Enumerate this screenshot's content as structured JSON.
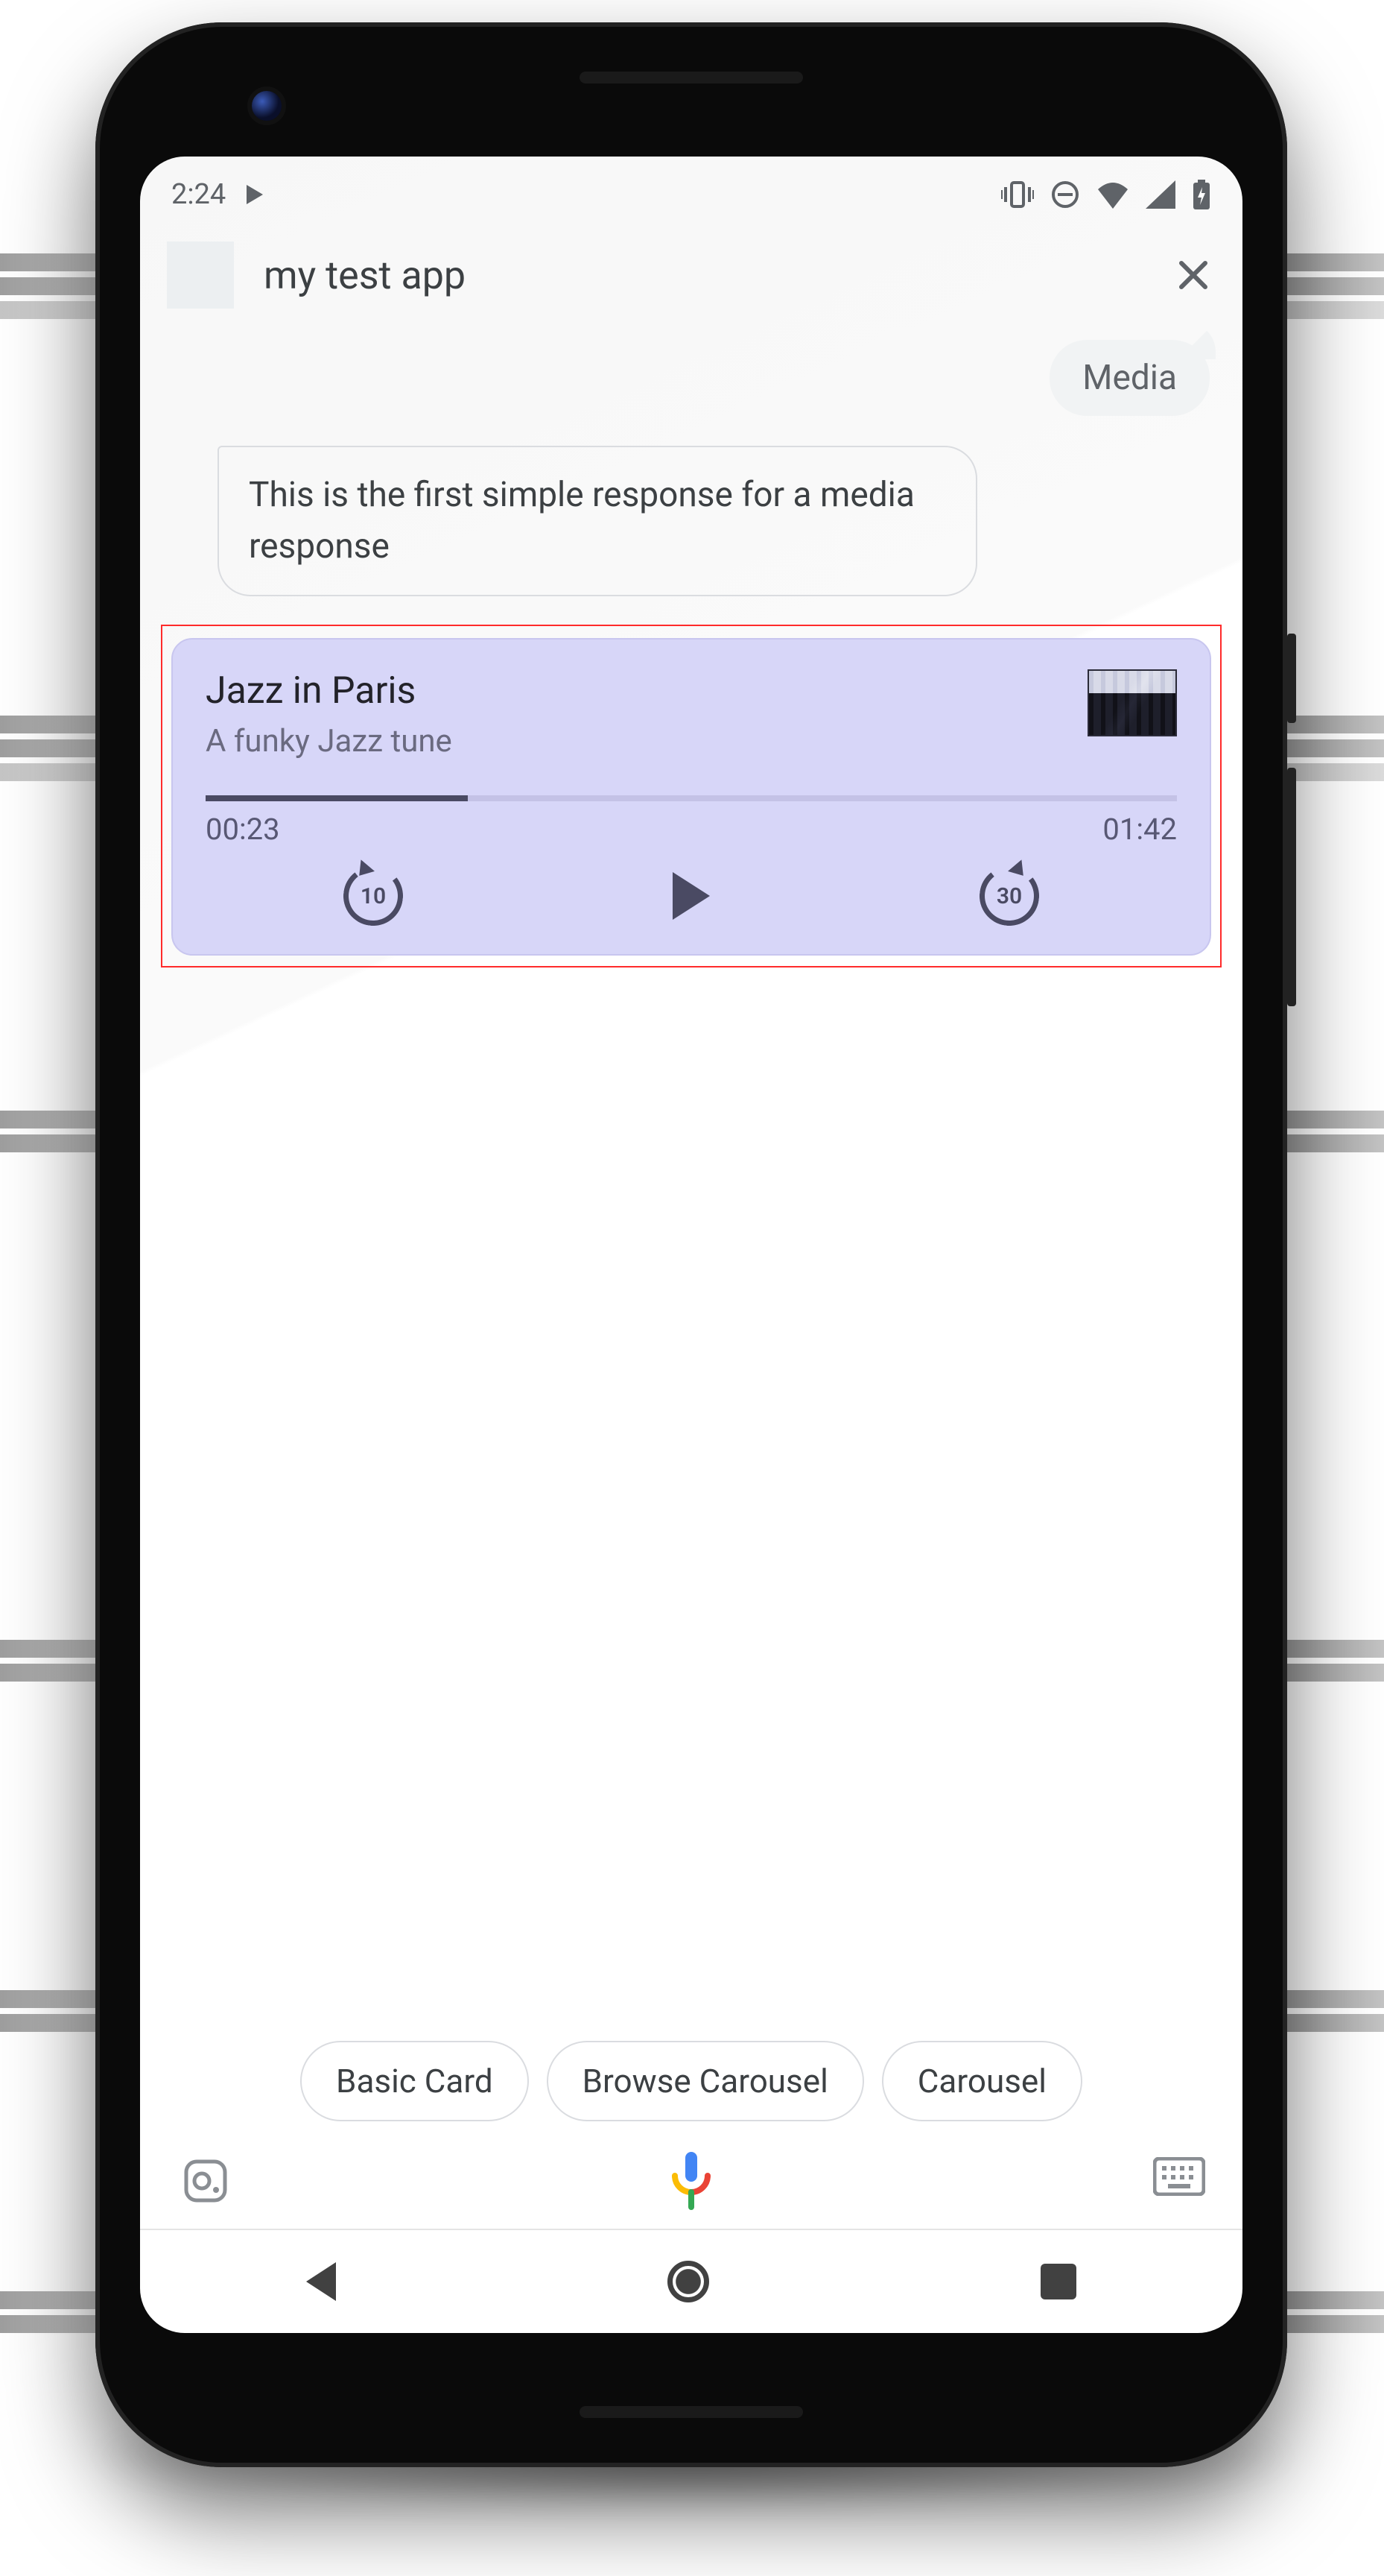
{
  "statusbar": {
    "time": "2:24"
  },
  "header": {
    "title": "my test app"
  },
  "chat": {
    "user_message": "Media",
    "assistant_message": "This is the first simple response for a media response"
  },
  "media": {
    "title": "Jazz in Paris",
    "subtitle": "A funky Jazz tune",
    "elapsed": "00:23",
    "duration": "01:42",
    "rewind_seconds": "10",
    "forward_seconds": "30",
    "progress_percent": 27
  },
  "chips": [
    "Basic Card",
    "Browse Carousel",
    "Carousel"
  ]
}
